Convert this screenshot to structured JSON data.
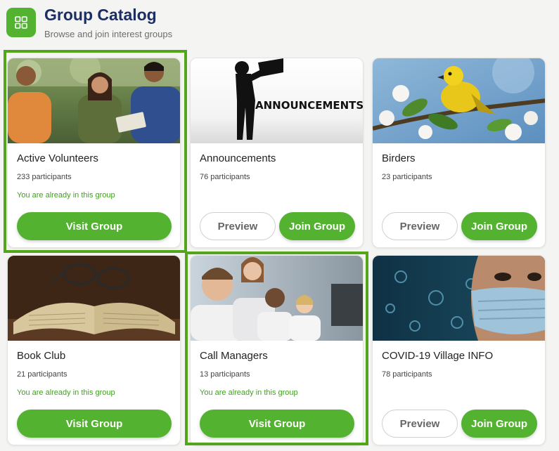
{
  "header": {
    "title": "Group Catalog",
    "subtitle": "Browse and join interest groups",
    "icon": "grid-icon",
    "accent": "#53b230"
  },
  "actions": {
    "visit": "Visit Group",
    "preview": "Preview",
    "join": "Join Group"
  },
  "groups": [
    {
      "name": "Active Volunteers",
      "participants": "233 participants",
      "status": "You are already in this group",
      "joined": true,
      "selected": true,
      "image": "volunteers-photo"
    },
    {
      "name": "Announcements",
      "participants": "76 participants",
      "joined": false,
      "image": "announcements-megaphone-graphic",
      "image_text": "ANNOUNCEMENTS"
    },
    {
      "name": "Birders",
      "participants": "23 participants",
      "joined": false,
      "image": "yellow-bird-photo"
    },
    {
      "name": "Book Club",
      "participants": "21 participants",
      "status": "You are already in this group",
      "joined": true,
      "image": "book-glasses-photo"
    },
    {
      "name": "Call Managers",
      "participants": "13 participants",
      "status": "You are already in this group",
      "joined": true,
      "selected": true,
      "image": "call-center-photo"
    },
    {
      "name": "COVID-19 Village INFO",
      "participants": "78 participants",
      "joined": false,
      "image": "covid-mask-photo"
    }
  ]
}
